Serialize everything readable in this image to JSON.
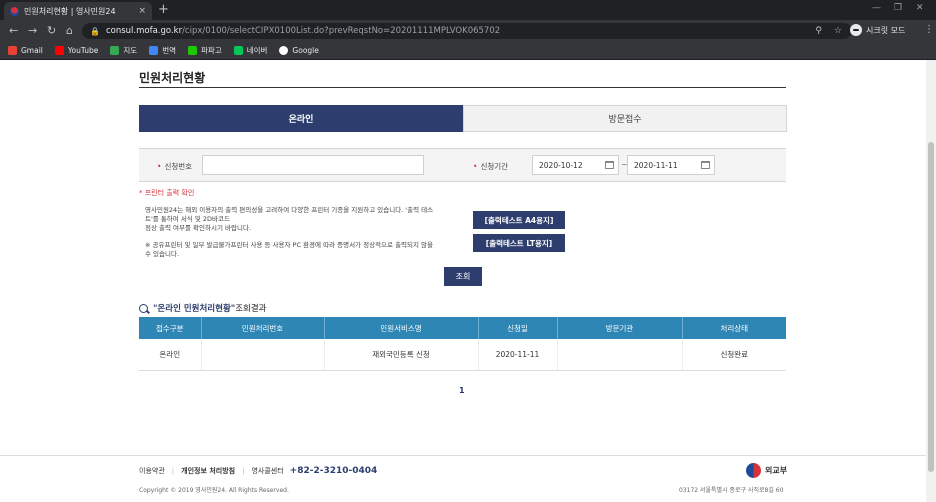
{
  "browser": {
    "tab_title": "민원처리현황 | 영사민원24",
    "tab_close": "×",
    "new_tab": "+",
    "url_host": "consul.mofa.go.kr",
    "url_path": "/cipx/0100/selectCIPX0100List.do?prevReqstNo=20201111MPLVOK065702",
    "incognito_label": "시크릿 모드",
    "bookmarks": [
      "Gmail",
      "YouTube",
      "지도",
      "번역",
      "파파고",
      "네이버",
      "Google"
    ],
    "bookmark_colors": [
      "#ea4335",
      "#ff0000",
      "#34a853",
      "#4285f4",
      "#1ec800",
      "#03c75a",
      "#ffffff"
    ]
  },
  "page": {
    "title": "민원처리현황",
    "tabs": {
      "online": "온라인",
      "visit": "방문접수"
    },
    "search": {
      "request_no_label": "신청번호",
      "request_no_value": "",
      "period_label": "신청기간",
      "date_from": "2020-10-12",
      "date_to": "2020-11-11",
      "tilde": "~"
    },
    "print": {
      "notice": "* 프린터 출력 확인",
      "desc1_line1": "영사민원24는 해외 이용자의 출력 편의성을 고려하여 다양한 프린터 기종을 지원하고 있습니다. '출력 테스",
      "desc1_line2": "트'를 통하여 서식 및 2D바코드",
      "desc1_line3": "정상 출력 여부를 확인하시기 바랍니다.",
      "desc2_line1": "※ 공유프린터 및 일부 발급불가프린터 사용 등 사용자 PC 환경에 따라 증명서가 정상적으로 출력되지 않을",
      "desc2_line2": "수 있습니다.",
      "btn_a4": "[출력테스트 A4용지]",
      "btn_lt": "[출력테스트 LT용지]"
    },
    "search_button": "조회",
    "result": {
      "title_highlight": "\"온라인 민원처리현황\"",
      "title_suffix": " 조회결과",
      "headers": [
        "접수구분",
        "민원처리번호",
        "민원서비스명",
        "신청일",
        "방문기관",
        "처리상태"
      ],
      "rows": [
        [
          "온라인",
          "",
          "재외국민등록 신청",
          "2020-11-11",
          "",
          "신청완료"
        ]
      ]
    },
    "pager": "1"
  },
  "footer": {
    "terms": "이용약관",
    "privacy": "개인정보 처리방침",
    "center": "영사콜센터",
    "phone": "+82-2-3210-0404",
    "copyright": "Copyright © 2019 영사민원24. All Rights Reserved.",
    "ministry": "외교부",
    "address": "03172 서울특별시 종로구 사직로8길 60"
  }
}
